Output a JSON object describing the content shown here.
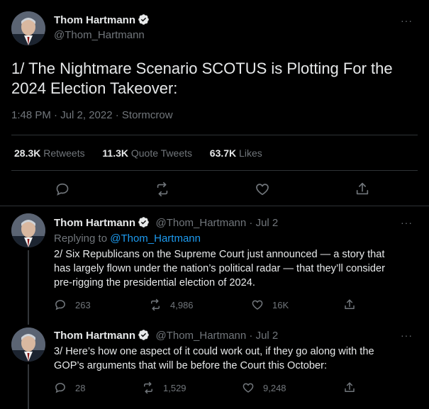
{
  "main_tweet": {
    "author_name": "Thom Hartmann",
    "handle": "@Thom_Hartmann",
    "text_line1": "1/ The Nightmare Scenario SCOTUS is Plotting For the",
    "text_line2": "2024 Election Takeover:",
    "meta": "1:48 PM · Jul 2, 2022 · Stormcrow",
    "stats": {
      "retweets_num": "28.3K",
      "retweets_label": "Retweets",
      "quotes_num": "11.3K",
      "quotes_label": "Quote Tweets",
      "likes_num": "63.7K",
      "likes_label": "Likes"
    }
  },
  "replies": [
    {
      "author_name": "Thom Hartmann",
      "handle_date": "@Thom_Hartmann · Jul 2",
      "replying_prefix": "Replying to",
      "replying_to": "@Thom_Hartmann",
      "lines": [
        "2/ Six Republicans on the Supreme Court just announced — a story that",
        "has largely flown under the nation’s political radar — that they’ll consider",
        "pre-rigging the presidential election of 2024."
      ],
      "reply_count": "263",
      "retweet_count": "4,986",
      "like_count": "16K"
    },
    {
      "author_name": "Thom Hartmann",
      "handle_date": "@Thom_Hartmann · Jul 2",
      "lines": [
        "3/ Here’s how one aspect of it could work out, if they go along with the",
        "GOP’s arguments that will be before the Court this October:"
      ],
      "reply_count": "28",
      "retweet_count": "1,529",
      "like_count": "9,248"
    }
  ],
  "icons": {
    "reply": "reply-icon",
    "retweet": "retweet-icon",
    "like": "heart-icon",
    "share": "share-icon",
    "verified": "verified-badge-icon",
    "more": "more-icon"
  },
  "colors": {
    "accent": "#1d9bf0",
    "muted": "#71767b",
    "text": "#e7e9ea",
    "background": "#000000"
  },
  "more_glyph": "···"
}
